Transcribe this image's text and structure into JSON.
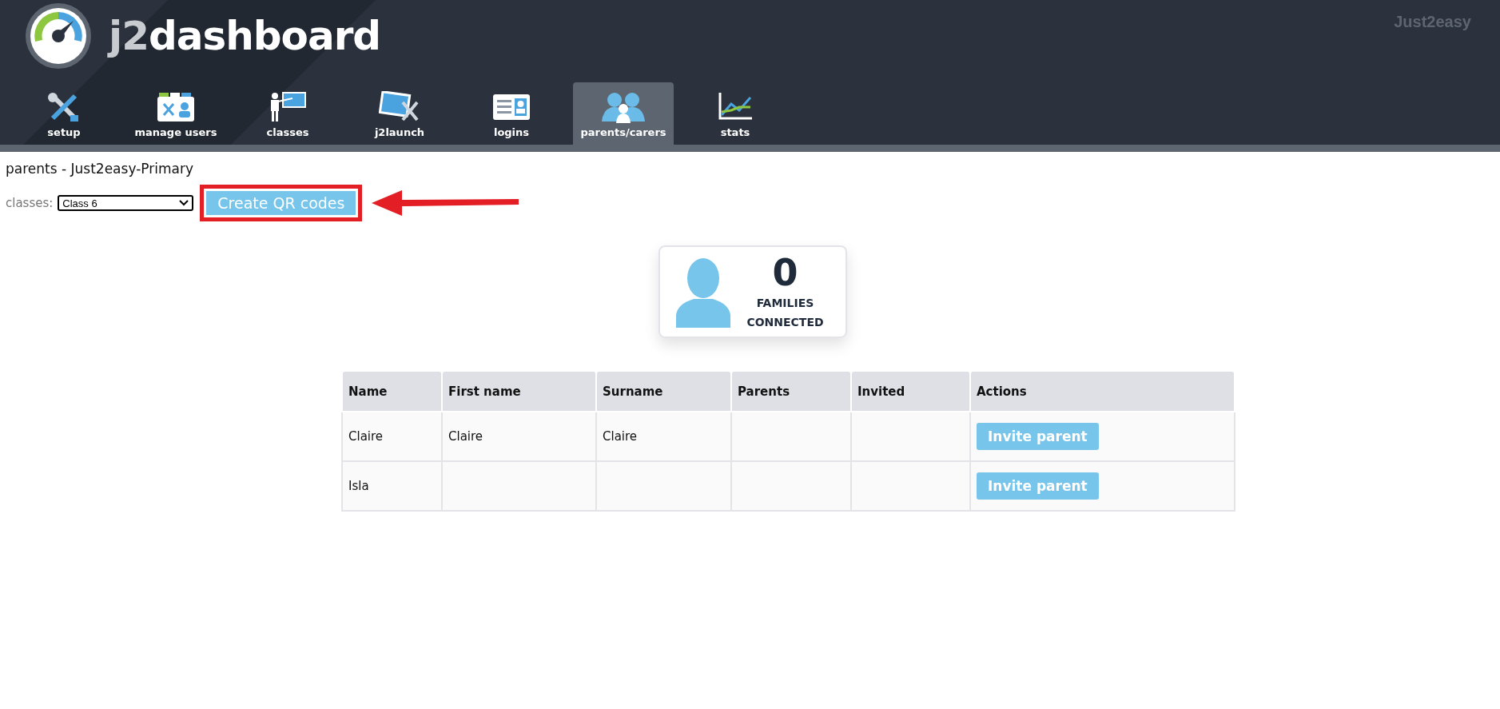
{
  "header": {
    "logo_text_prefix": "j2",
    "logo_text": "dashboard",
    "brand": "Just2easy"
  },
  "tabs": [
    {
      "label": "setup",
      "kind": "tools",
      "selected": false
    },
    {
      "label": "manage users",
      "kind": "folder",
      "selected": false
    },
    {
      "label": "classes",
      "kind": "teacher",
      "selected": false
    },
    {
      "label": "j2launch",
      "kind": "launch",
      "selected": false
    },
    {
      "label": "logins",
      "kind": "card",
      "selected": false
    },
    {
      "label": "parents/carers",
      "kind": "parents",
      "selected": true
    },
    {
      "label": "stats",
      "kind": "chart",
      "selected": false
    }
  ],
  "page_title": "parents - Just2easy-Primary",
  "classes_filter": {
    "label": "classes:",
    "value": "Class 6"
  },
  "create_button": "Create QR codes",
  "stat_card": {
    "value": "0",
    "label_line1": "FAMILIES",
    "label_line2": "CONNECTED"
  },
  "table": {
    "columns": [
      "Name",
      "First name",
      "Surname",
      "Parents",
      "Invited",
      "Actions"
    ],
    "rows": [
      {
        "name": "Claire",
        "first_name": "Claire",
        "surname": "Claire",
        "action": "Invite parent"
      },
      {
        "name": "Isla",
        "first_name": "",
        "surname": "",
        "action": "Invite parent"
      }
    ]
  }
}
